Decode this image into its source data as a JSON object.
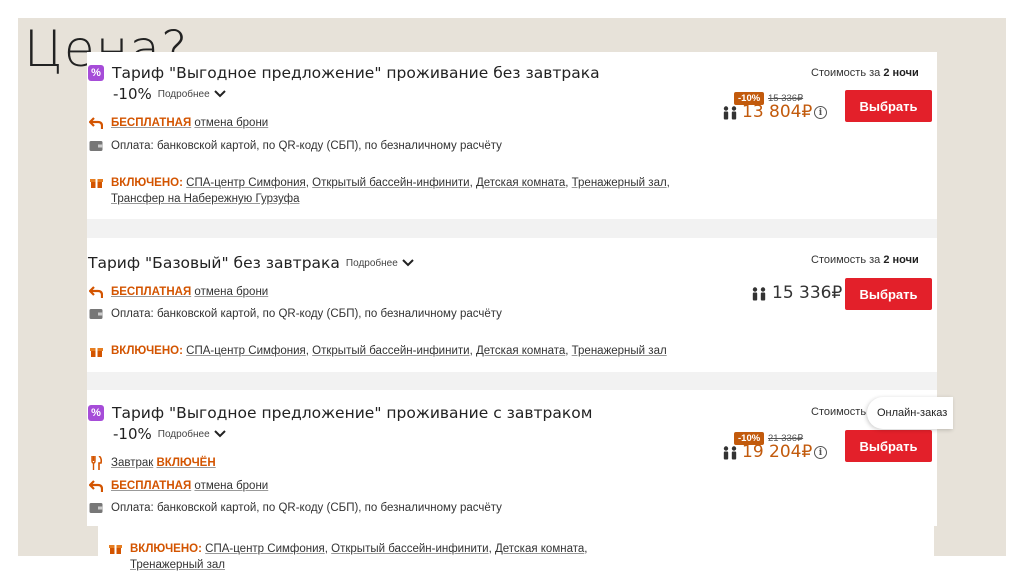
{
  "slide": {
    "title": "Цена?"
  },
  "common": {
    "more_label": "Подробнее",
    "free_label": "БЕСПЛАТНАЯ",
    "cancel_label": "отмена брони",
    "payment_label": "Оплата: банковской картой, по QR-коду (СБП), по безналичному расчёту",
    "included_label": "ВКЛЮЧЕНО:",
    "stay_prefix": "Стоимость за",
    "stay_nights": "2 ночи",
    "select_label": "Выбрать"
  },
  "rates": [
    {
      "title": "Тариф \"Выгодное предложение\" проживание без завтрака",
      "discount_text": "-10%",
      "included_items": [
        "СПА-центр Симфония",
        "Открытый бассейн-инфинити",
        "Детская комната",
        "Тренажерный зал",
        "Трансфер на Набережную Гурзуфа"
      ],
      "badge": "-10%",
      "old_price": "15 336₽",
      "price": "13 804₽"
    },
    {
      "title": "Тариф \"Базовый\" без завтрака",
      "included_items": [
        "СПА-центр Симфония",
        "Открытый бассейн-инфинити",
        "Детская комната",
        "Тренажерный зал"
      ],
      "price": "15 336₽"
    },
    {
      "title": "Тариф \"Выгодное предложение\" проживание с завтраком",
      "discount_text": "-10%",
      "breakfast_label": "Завтрак",
      "breakfast_value": "ВКЛЮЧЁН",
      "included_items": [
        "СПА-центр Симфония",
        "Открытый бассейн-инфинити",
        "Детская комната",
        "Тренажерный зал"
      ],
      "stay_prefix_partial": "Стоимость",
      "badge": "-10%",
      "old_price": "21 336₽",
      "price": "19 204₽"
    }
  ],
  "online_order": {
    "label": "Онлайн-заказ"
  },
  "colors": {
    "accent_orange": "#d35400",
    "button_red": "#e3202a",
    "promo_purple": "#a64cd8",
    "slide_bg": "#e7e2d9"
  },
  "icons": [
    "percent-tag-icon",
    "chevron-down-icon",
    "cancel-return-icon",
    "wallet-icon",
    "gift-icon",
    "guests-icon",
    "info-icon",
    "fork-knife-icon"
  ]
}
